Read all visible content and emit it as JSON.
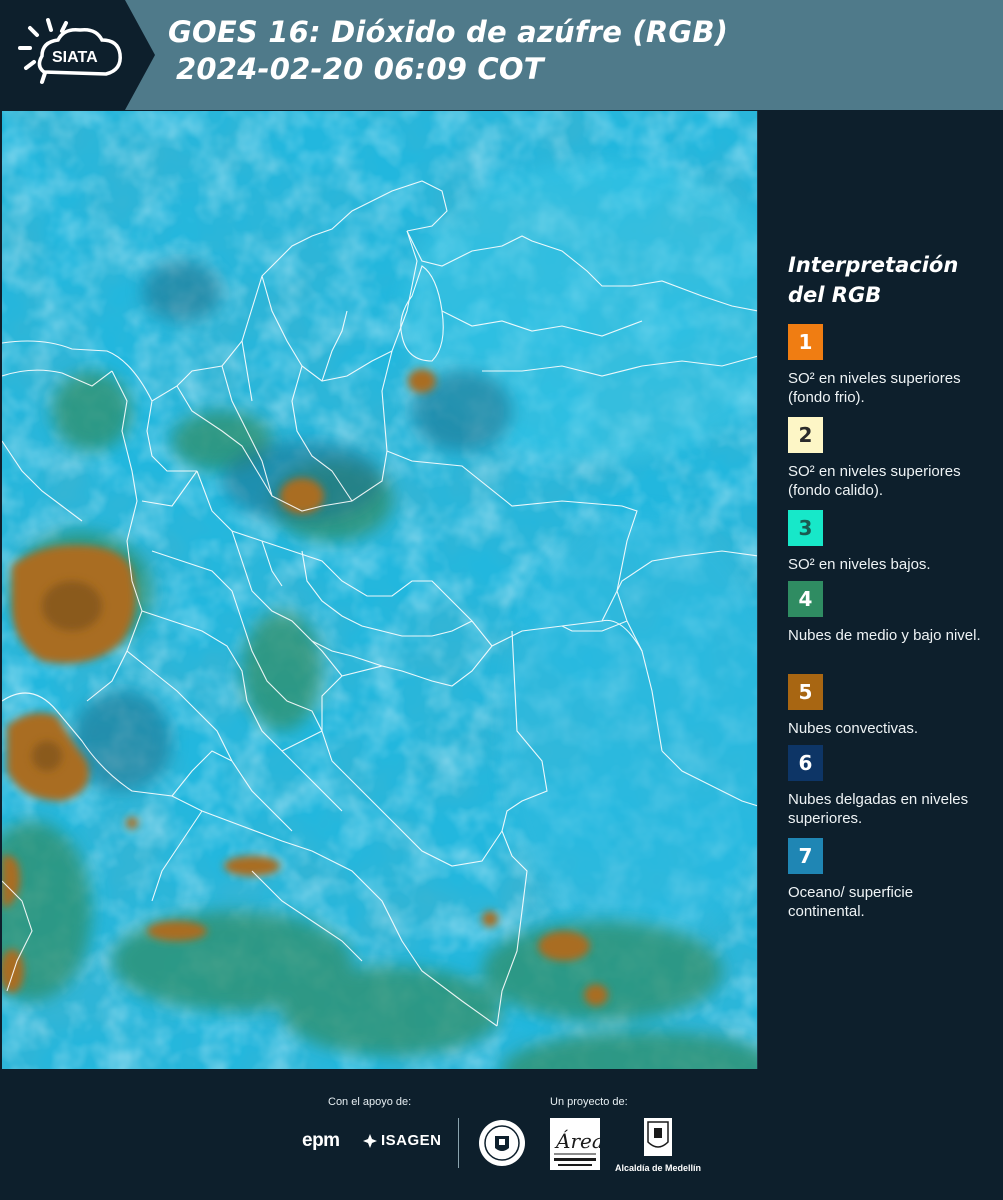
{
  "header": {
    "logo_text": "SIATA",
    "title_line1": "GOES 16: Dióxido de azúfre (RGB)",
    "title_line2": "2024-02-20 06:09 COT"
  },
  "legend": {
    "title_line1": "Interpretación",
    "title_line2": "del RGB",
    "items": [
      {
        "number": "1",
        "color": "#f07d12",
        "text": "SO² en niveles superiores (fondo frio)."
      },
      {
        "number": "2",
        "color": "#fdf6c6",
        "text": "SO² en niveles superiores (fondo calido)."
      },
      {
        "number": "3",
        "color": "#17e8c9",
        "text": "SO² en niveles bajos."
      },
      {
        "number": "4",
        "color": "#2f8c62",
        "text": "Nubes de medio y bajo nivel."
      },
      {
        "number": "5",
        "color": "#a86612",
        "text": "Nubes convectivas."
      },
      {
        "number": "6",
        "color": "#0d3566",
        "text": "Nubes delgadas en niveles superiores."
      },
      {
        "number": "7",
        "color": "#1f86b4",
        "text": "Oceano/ superficie continental."
      }
    ]
  },
  "footer": {
    "support_label": "Con el apoyo de:",
    "project_label": "Un proyecto de:",
    "sponsors": [
      "epm",
      "ISAGEN"
    ],
    "partners": [
      "Medellín",
      "Área Metropolitana Valle de Aburrá",
      "Alcaldía de Medellín"
    ]
  },
  "colors": {
    "header_bg": "#4f7a8a",
    "page_bg": "#0d1f2c",
    "map_base": "#23b4dc",
    "cloud_convective": "#a86a1e",
    "cloud_mid": "#2f8c62"
  }
}
